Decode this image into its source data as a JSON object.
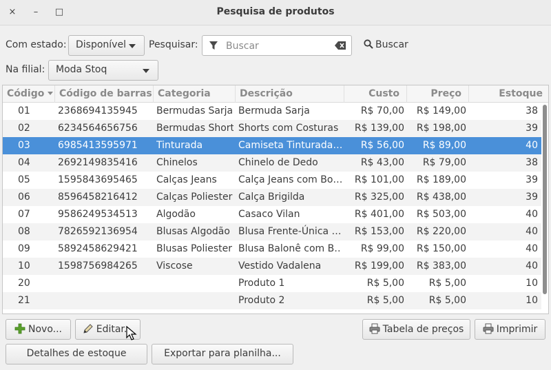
{
  "window": {
    "title": "Pesquisa de produtos",
    "close_icon": "×",
    "minimize_icon": "–",
    "maximize_icon": "□"
  },
  "filters": {
    "estado_label": "Com estado:",
    "estado_value": "Disponível",
    "pesquisar_label": "Pesquisar:",
    "search_placeholder": "Buscar",
    "buscar_button": "Buscar",
    "filial_label": "Na filial:",
    "filial_value": "Moda Stoq"
  },
  "table": {
    "columns": [
      "Código",
      "Código de barras",
      "Categoria",
      "Descrição",
      "Custo",
      "Preço",
      "Estoque"
    ],
    "rows": [
      [
        "01",
        "2368694135945",
        "Bermudas Sarja",
        "Bermuda Sarja",
        "R$ 70,00",
        "R$ 149,00",
        "38"
      ],
      [
        "02",
        "6234564656756",
        "Bermudas Shorts",
        "Shorts com Costuras",
        "R$ 139,00",
        "R$ 198,00",
        "39"
      ],
      [
        "03",
        "6985413595971",
        "Tinturada",
        "Camiseta Tinturada…",
        "R$ 56,00",
        "R$ 89,00",
        "40"
      ],
      [
        "04",
        "2692149835416",
        "Chinelos",
        "Chinelo de Dedo",
        "R$ 43,00",
        "R$ 79,00",
        "38"
      ],
      [
        "05",
        "1595843695465",
        "Calças Jeans",
        "Calça Jeans com Bo…",
        "R$ 101,00",
        "R$ 189,00",
        "39"
      ],
      [
        "06",
        "8596458216412",
        "Calças Poliester",
        "Calça Brigilda",
        "R$ 325,00",
        "R$ 438,00",
        "39"
      ],
      [
        "07",
        "9586249534513",
        "Algodão",
        "Casaco Vilan",
        "R$ 401,00",
        "R$ 503,00",
        "40"
      ],
      [
        "08",
        "7826592136954",
        "Blusas Algodão",
        "Blusa Frente-Única …",
        "R$ 153,00",
        "R$ 220,00",
        "40"
      ],
      [
        "09",
        "5892458629421",
        "Blusas Poliester",
        "Blusa Balonê com B…",
        "R$ 99,00",
        "R$ 150,00",
        "40"
      ],
      [
        "10",
        "1598756984265",
        "Viscose",
        "Vestido Vadalena",
        "R$ 199,00",
        "R$ 383,00",
        "40"
      ],
      [
        "20",
        "",
        "",
        "Produto 1",
        "R$ 5,00",
        "R$ 5,00",
        "10"
      ],
      [
        "21",
        "",
        "",
        "Produto 2",
        "R$ 5,00",
        "R$ 5,00",
        "10"
      ]
    ],
    "selected_row_index": 2
  },
  "buttons": {
    "novo": "Novo...",
    "editar": "Editar...",
    "tabela_precos": "Tabela de preços",
    "imprimir": "Imprimir",
    "detalhes_estoque": "Detalhes de estoque",
    "exportar": "Exportar para planilha..."
  },
  "icons": {
    "filter": "filter-icon",
    "clear": "clear-text-icon",
    "search": "magnifier-icon",
    "add": "plus-icon",
    "edit": "pencil-icon",
    "print": "printer-icon"
  },
  "colors": {
    "selection": "#4a90d9",
    "add_icon": "#5aa02c"
  }
}
